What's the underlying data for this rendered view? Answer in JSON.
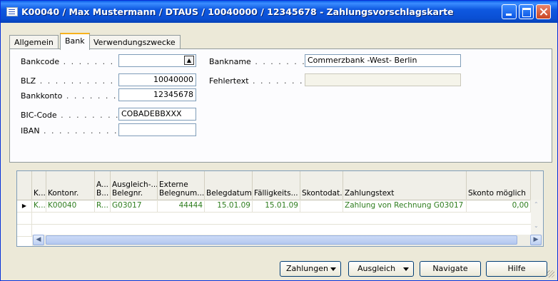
{
  "window": {
    "title": "K00040 / Max Mustermann / DTAUS / 10040000 / 12345678 - Zahlungsvorschlagskarte"
  },
  "tabs": [
    "Allgemein",
    "Bank",
    "Verwendungszwecke"
  ],
  "active_tab": "Bank",
  "form": {
    "bankcode_label": "Bankcode",
    "bankcode_value": "",
    "blz_label": "BLZ",
    "blz_value": "10040000",
    "bankkonto_label": "Bankkonto",
    "bankkonto_value": "12345678",
    "bic_label": "BIC-Code",
    "bic_value": "COBADEBBXXX",
    "iban_label": "IBAN",
    "iban_value": "",
    "bankname_label": "Bankname",
    "bankname_value": "Commerzbank -West- Berlin",
    "fehlertext_label": "Fehlertext",
    "fehlertext_value": "",
    "lookup_icon": "lookup-arrow-icon"
  },
  "grid": {
    "columns": [
      "",
      "K...",
      "Kontonr.",
      "A... B...",
      "Ausgleich-... Belegnr.",
      "Externe Belegnum...",
      "Belegdatum",
      "Fälligkeits...",
      "Skontodat...",
      "Zahlungstext",
      "Skonto möglich"
    ],
    "rows": [
      {
        "marker": "▶",
        "k": "K...",
        "kontonr": "K00040",
        "ab": "R...",
        "ausgleich_belegnr": "G03017",
        "externe_belegnr": "44444",
        "belegdatum": "15.01.09",
        "faelligkeit": "15.01.09",
        "skontodatum": "",
        "zahlungstext": "Zahlung von Rechnung G03017",
        "skonto_moeglich": "0,00"
      }
    ],
    "empty_rows": 2
  },
  "buttons": {
    "zahlungen": "Zahlungen",
    "ausgleich": "Ausgleich",
    "navigate": "Navigate",
    "hilfe": "Hilfe"
  },
  "colors": {
    "title_bar": "#0a4fd4",
    "row_text": "#2e7d1e",
    "tab_highlight": "#f7b21c"
  }
}
